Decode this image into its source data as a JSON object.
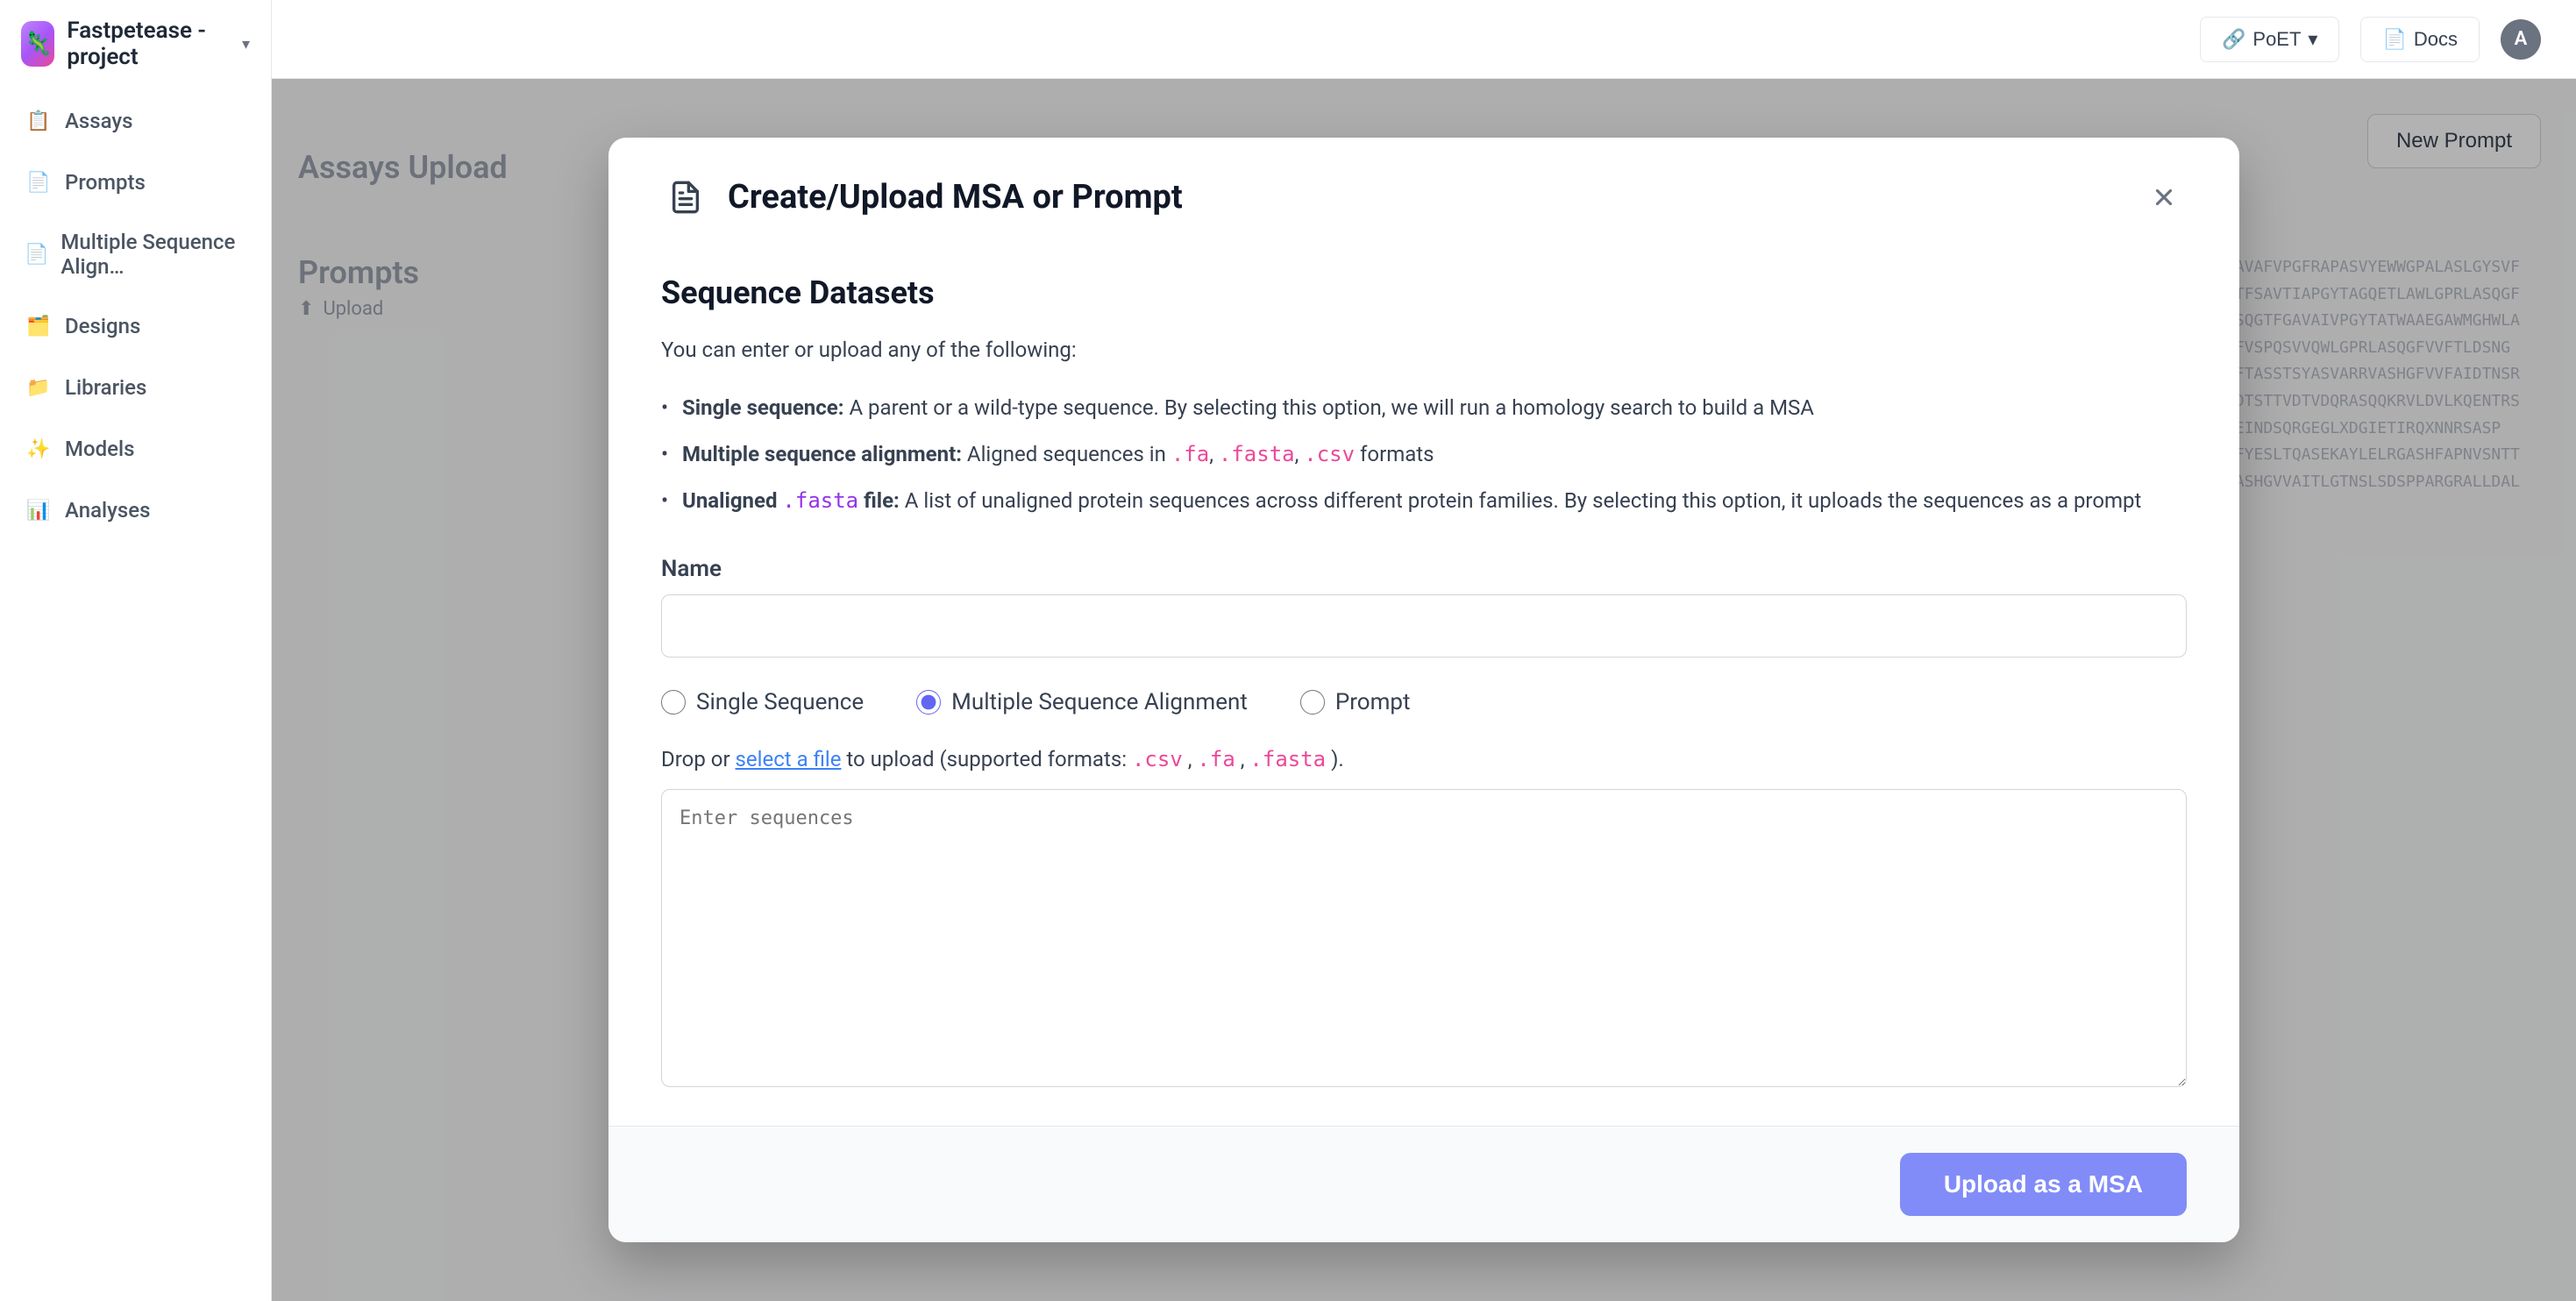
{
  "app": {
    "title": "Fastpetease - project",
    "logo_emoji": "🦎"
  },
  "sidebar": {
    "items": [
      {
        "id": "assays",
        "label": "Assays",
        "icon": "📋"
      },
      {
        "id": "prompts",
        "label": "Prompts",
        "icon": "📄"
      },
      {
        "id": "msa",
        "label": "Multiple Sequence Align…",
        "icon": "📄"
      },
      {
        "id": "designs",
        "label": "Designs",
        "icon": "🗂️"
      },
      {
        "id": "libraries",
        "label": "Libraries",
        "icon": "📁"
      },
      {
        "id": "models",
        "label": "Models",
        "icon": "✨"
      },
      {
        "id": "analyses",
        "label": "Analyses",
        "icon": "📊"
      }
    ],
    "upload_label": "Upload"
  },
  "topbar": {
    "poet_label": "PoET",
    "docs_label": "Docs",
    "avatar_letter": "A",
    "new_prompt_label": "New Prompt"
  },
  "background": {
    "sections": [
      {
        "id": "assays-upload",
        "title": "Assays Upload"
      },
      {
        "id": "prompts",
        "title": "Prompts"
      }
    ],
    "sequence_lines": [
      "GAVAFVPGFRAPASVYEWWGPALASLGYSVF",
      "GTFSAVTIAPGYTAGQETLAWLGPRLASQGF",
      "TSQGTFGAVAIVPGYTATWAAEGAWMGHWLA",
      "GFVSPQSVVQWLGPRLASQGFVVFTLDSNG",
      "GFTASSTSYASVARRVASHGFVVFAIDTNSR",
      "MDTSTTVDTVDQRASQQKRVLDVLKQENTRS",
      "DEINDSQRGEGLXDGIETIRQXNNRSASP",
      "PFYESLTQASEKAYLELRGASHFAPNVSNTT",
      "MASHGVVAITLGTNSLSDSPPARGRALLDAL"
    ]
  },
  "modal": {
    "title": "Create/Upload MSA or Prompt",
    "close_label": "×",
    "section_heading": "Sequence Datasets",
    "description": "You can enter or upload any of the following:",
    "bullets": [
      {
        "prefix": "Single sequence:",
        "text": " A parent or a wild-type sequence. By selecting this option, we will run a homology search to build a MSA"
      },
      {
        "prefix": "Multiple sequence alignment:",
        "text": " Aligned sequences in ",
        "codes": [
          ".fa",
          ".fasta",
          ".csv"
        ],
        "suffix": " formats"
      },
      {
        "prefix": "Unaligned ",
        "code_inline": ".fasta",
        "text2": " file:",
        "text": " A list of unaligned protein sequences across different protein families. By selecting this option, it uploads the sequences as a prompt"
      }
    ],
    "name_label": "Name",
    "name_placeholder": "",
    "radio_options": [
      {
        "id": "single-sequence",
        "label": "Single Sequence",
        "checked": false
      },
      {
        "id": "multiple-sequence-alignment",
        "label": "Multiple Sequence Alignment",
        "checked": true
      },
      {
        "id": "prompt",
        "label": "Prompt",
        "checked": false
      }
    ],
    "upload_hint_prefix": "Drop or ",
    "upload_hint_link": "select a file",
    "upload_hint_suffix": " to upload (supported formats: ",
    "upload_formats": [
      ".csv",
      ".fa",
      ".fasta"
    ],
    "upload_hint_end": ").",
    "textarea_placeholder": "Enter sequences",
    "submit_label": "Upload as a MSA"
  }
}
